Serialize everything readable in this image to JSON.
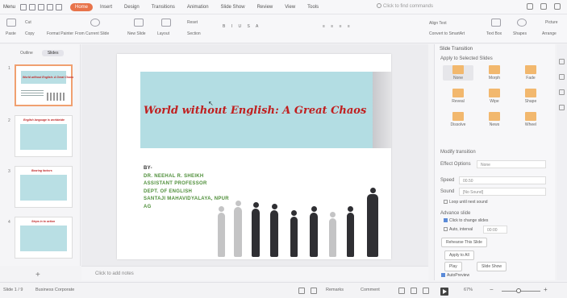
{
  "menubar": {
    "menu_label": "Menu",
    "tabs": [
      "Home",
      "Insert",
      "Design",
      "Transitions",
      "Animation",
      "Slide Show",
      "Review",
      "View",
      "Tools"
    ],
    "active_tab": "Home",
    "search_placeholder": "Click to find commands"
  },
  "ribbon": {
    "paste": "Paste",
    "cut": "Cut",
    "copy": "Copy",
    "format_painter": "Format Painter",
    "from_current_slide": "From Current Slide",
    "new_slide": "New Slide",
    "layout": "Layout",
    "reset": "Reset",
    "section": "Section",
    "text_box": "Text Box",
    "shapes": "Shapes",
    "arrange": "Arrange",
    "picture": "Picture",
    "convert_to_smartart": "Convert to SmartArt",
    "align_text": "Align Text"
  },
  "left_panel": {
    "tabs": [
      "Outline",
      "Slides"
    ],
    "active_tab": "Slides",
    "slide_numbers": [
      "1",
      "2",
      "3",
      "4"
    ],
    "thumb_titles": [
      "World without English: A Great Chaos",
      "English language is worldwide",
      "Bearing factors",
      "Steps in to action"
    ]
  },
  "slide": {
    "title": "World without English: A Great Chaos",
    "by": "BY-",
    "author_lines": [
      "DR. NEEHAL R. SHEIKH",
      "ASSISTANT PROFESSOR",
      "DEPT. OF ENGLISH",
      "SANTAJI MAHAVIDYALAYA, NPUR",
      "AG"
    ]
  },
  "notes_placeholder": "Click to add notes",
  "right_panel": {
    "title": "Slide Transition",
    "apply_to": "Apply to Selected Slides",
    "transitions": [
      {
        "label": "None",
        "selected": true
      },
      {
        "label": "Morph",
        "selected": false
      },
      {
        "label": "Fade",
        "selected": false
      },
      {
        "label": "Reveal",
        "selected": false
      },
      {
        "label": "Wipe",
        "selected": false
      },
      {
        "label": "Shape",
        "selected": false
      },
      {
        "label": "Dissolve",
        "selected": false
      },
      {
        "label": "News",
        "selected": false
      },
      {
        "label": "Wheel",
        "selected": false
      }
    ],
    "modify_heading": "Modify transition",
    "effect_options_label": "Effect Options",
    "effect_options_value": "None",
    "speed_label": "Speed",
    "speed_value": "00.50",
    "sound_label": "Sound",
    "sound_value": "[No Sound]",
    "loop_label": "Loop until next sound",
    "advance_heading": "Advance slide",
    "on_click_label": "Click to change slides",
    "auto_label": "Auto, interval",
    "auto_value": "00:00",
    "rehearse": "Rehearse This Slide",
    "apply_all": "Apply to All",
    "play": "Play",
    "slide_show": "Slide Show",
    "autopreview": "AutoPreview"
  },
  "status_bar": {
    "slide_counter": "Slide 1 / 9",
    "theme": "Business Corporate",
    "remarks": "Remarks",
    "comment": "Comment",
    "zoom": "67%"
  },
  "colors": {
    "accent": "#e8734a",
    "title_red": "#c01f1f",
    "author_green": "#4f8f3a",
    "band": "#b3dde3"
  }
}
